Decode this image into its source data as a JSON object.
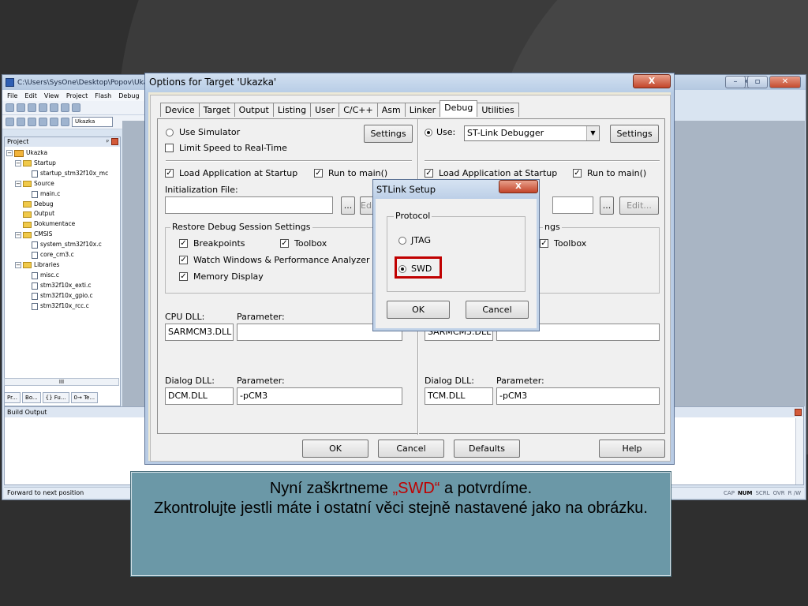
{
  "ide": {
    "title": "C:\\Users\\SysOne\\Desktop\\Popov\\Ukazka\\U",
    "menu": [
      "File",
      "Edit",
      "View",
      "Project",
      "Flash",
      "Debug"
    ],
    "target_select": "Ukazka",
    "project_panel": {
      "header": "Project",
      "pin": "ᵖ",
      "tree": [
        {
          "label": "Ukazka",
          "kind": "project",
          "level": 0,
          "expander": "−"
        },
        {
          "label": "Startup",
          "kind": "folder",
          "level": 1,
          "expander": "−"
        },
        {
          "label": "startup_stm32f10x_mc",
          "kind": "file",
          "level": 2,
          "expander": ""
        },
        {
          "label": "Source",
          "kind": "folder",
          "level": 1,
          "expander": "−"
        },
        {
          "label": "main.c",
          "kind": "file",
          "level": 2,
          "expander": ""
        },
        {
          "label": "Debug",
          "kind": "folder",
          "level": 1,
          "expander": ""
        },
        {
          "label": "Output",
          "kind": "folder",
          "level": 1,
          "expander": ""
        },
        {
          "label": "Dokumentace",
          "kind": "folder",
          "level": 1,
          "expander": ""
        },
        {
          "label": "CMSIS",
          "kind": "folder",
          "level": 1,
          "expander": "−"
        },
        {
          "label": "system_stm32f10x.c",
          "kind": "file",
          "level": 2,
          "expander": ""
        },
        {
          "label": "core_cm3.c",
          "kind": "file",
          "level": 2,
          "expander": ""
        },
        {
          "label": "Libraries",
          "kind": "folder",
          "level": 1,
          "expander": "−"
        },
        {
          "label": "misc.c",
          "kind": "file",
          "level": 2,
          "expander": ""
        },
        {
          "label": "stm32f10x_exti.c",
          "kind": "file",
          "level": 2,
          "expander": ""
        },
        {
          "label": "stm32f10x_gpio.c",
          "kind": "file",
          "level": 2,
          "expander": ""
        },
        {
          "label": "stm32f10x_rcc.c",
          "kind": "file",
          "level": 2,
          "expander": ""
        }
      ],
      "scroll_label": "III",
      "tabs": [
        "Pr...",
        "Bo...",
        "{} Fu...",
        "0→ Te..."
      ]
    },
    "build_output": {
      "header": "Build Output"
    },
    "status": {
      "left": "Forward to next position",
      "indicators": [
        "CAP",
        "NUM",
        "SCRL",
        "OVR",
        "R /W"
      ],
      "active_indicator": "NUM"
    }
  },
  "options_dialog": {
    "title": "Options for Target 'Ukazka'",
    "close_label": "X",
    "tabs": [
      "Device",
      "Target",
      "Output",
      "Listing",
      "User",
      "C/C++",
      "Asm",
      "Linker",
      "Debug",
      "Utilities"
    ],
    "active_tab": "Debug",
    "left": {
      "use_simulator": "Use Simulator",
      "limit_speed": "Limit Speed to Real-Time",
      "settings": "Settings",
      "load_app": "Load Application at Startup",
      "run_to_main": "Run to main()",
      "init_file": "Initialization File:",
      "browse": "...",
      "edit": "Edit...",
      "restore_group": "Restore Debug Session Settings",
      "breakpoints": "Breakpoints",
      "toolbox": "Toolbox",
      "watch_windows": "Watch Windows & Performance Analyzer",
      "memory_display": "Memory Display",
      "cpu_dll_label": "CPU DLL:",
      "cpu_param_label": "Parameter:",
      "cpu_dll": "SARMCM3.DLL",
      "cpu_param": "",
      "dialog_dll_label": "Dialog DLL:",
      "dialog_param_label": "Parameter:",
      "dialog_dll": "DCM.DLL",
      "dialog_param": "-pCM3"
    },
    "right": {
      "use_label": "Use:",
      "debugger": "ST-Link Debugger",
      "settings": "Settings",
      "load_app": "Load Application at Startup",
      "run_to_main": "Run to main()",
      "browse": "...",
      "edit": "Edit...",
      "restore_group_tail": "ngs",
      "toolbox": "Toolbox",
      "cpu_dll": "SARMCM3.DLL",
      "cpu_param": "",
      "dialog_dll_label": "Dialog DLL:",
      "dialog_param_label": "Parameter:",
      "dialog_dll": "TCM.DLL",
      "dialog_param": "-pCM3"
    },
    "buttons": {
      "ok": "OK",
      "cancel": "Cancel",
      "defaults": "Defaults",
      "help": "Help"
    }
  },
  "stlink_dialog": {
    "title": "STLink Setup",
    "close_label": "X",
    "protocol_group": "Protocol",
    "jtag": "JTAG",
    "swd": "SWD",
    "selected": "SWD",
    "ok": "OK",
    "cancel": "Cancel"
  },
  "caption": {
    "line1_before": "Nyní zaškrtneme ",
    "line1_highlight": "„SWD“",
    "line1_after": " a potvrdíme.",
    "line2": "Zkontrolujte jestli máte i ostatní věci stejně nastavené jako na obrázku.",
    "highlight_color": "#c00000"
  }
}
